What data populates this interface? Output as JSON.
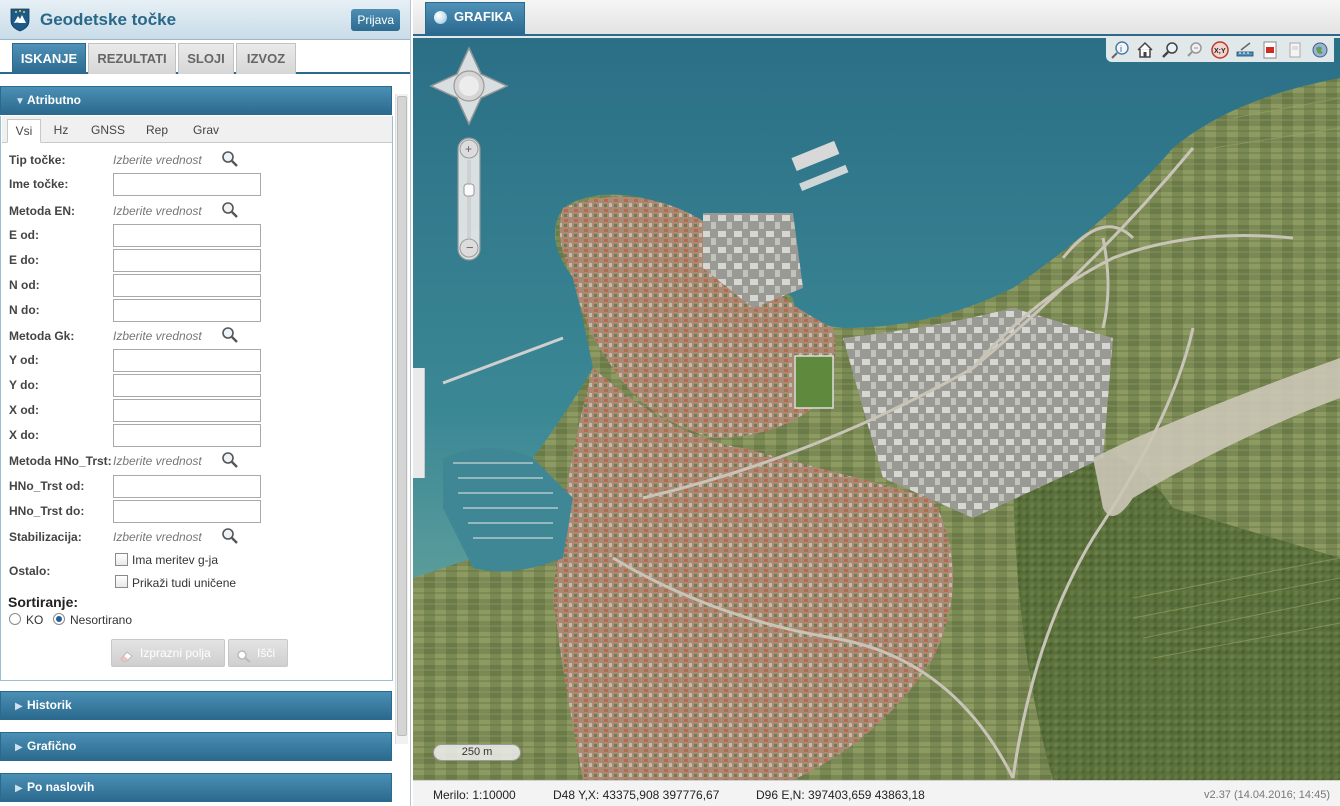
{
  "app": {
    "title": "Geodetske točke",
    "login_label": "Prijava"
  },
  "main_tabs": [
    {
      "label": "ISKANJE",
      "active": true
    },
    {
      "label": "REZULTATI",
      "active": false
    },
    {
      "label": "SLOJI",
      "active": false
    },
    {
      "label": "IZVOZ",
      "active": false
    }
  ],
  "attributes_panel": {
    "title": "Atributno",
    "sub_tabs": [
      "Vsi",
      "Hz",
      "GNSS",
      "Rep",
      "Grav"
    ],
    "pick_placeholder": "Izberite vrednost",
    "fields": {
      "tip_tocke": "Tip točke:",
      "ime_tocke": "Ime točke:",
      "metoda_en": "Metoda EN:",
      "e_od": "E od:",
      "e_do": "E do:",
      "n_od": "N od:",
      "n_do": "N do:",
      "metoda_gk": "Metoda Gk:",
      "y_od": "Y od:",
      "y_do": "Y do:",
      "x_od": "X od:",
      "x_do": "X do:",
      "metoda_hno": "Metoda HNo_Trst:",
      "hno_od": "HNo_Trst od:",
      "hno_do": "HNo_Trst do:",
      "stabilizacija": "Stabilizacija:",
      "ostalo": "Ostalo:"
    },
    "checkboxes": {
      "ima_meritev": "Ima meritev g-ja",
      "prikazi_unicene": "Prikaži tudi uničene"
    },
    "sorting": {
      "title": "Sortiranje:",
      "option_ko": "KO",
      "option_nesortirano": "Nesortirano",
      "selected": "Nesortirano"
    },
    "buttons": {
      "clear": "Izprazni polja",
      "search": "Išči"
    }
  },
  "accordion_sections": [
    "Historik",
    "Grafično",
    "Po naslovih"
  ],
  "map": {
    "tab_label": "GRAFIKA",
    "scale_label": "250 m",
    "status": {
      "scale": "Merilo: 1:10000",
      "d48": "D48 Y,X: 43375,908 397776,67",
      "d96": "D96 E,N: 397403,659 43863,18",
      "version": "v2.37 (14.04.2016; 14:45)"
    },
    "tools": [
      "identify-icon",
      "home-icon",
      "search-point-icon",
      "zoom-search-icon",
      "xy-coordinate-icon",
      "measure-icon",
      "pdf-icon",
      "print-icon",
      "globe-icon"
    ]
  },
  "colors": {
    "accent": "#2b6a8e",
    "sea": "#2f7a8e",
    "land": "#7e8a5a"
  }
}
